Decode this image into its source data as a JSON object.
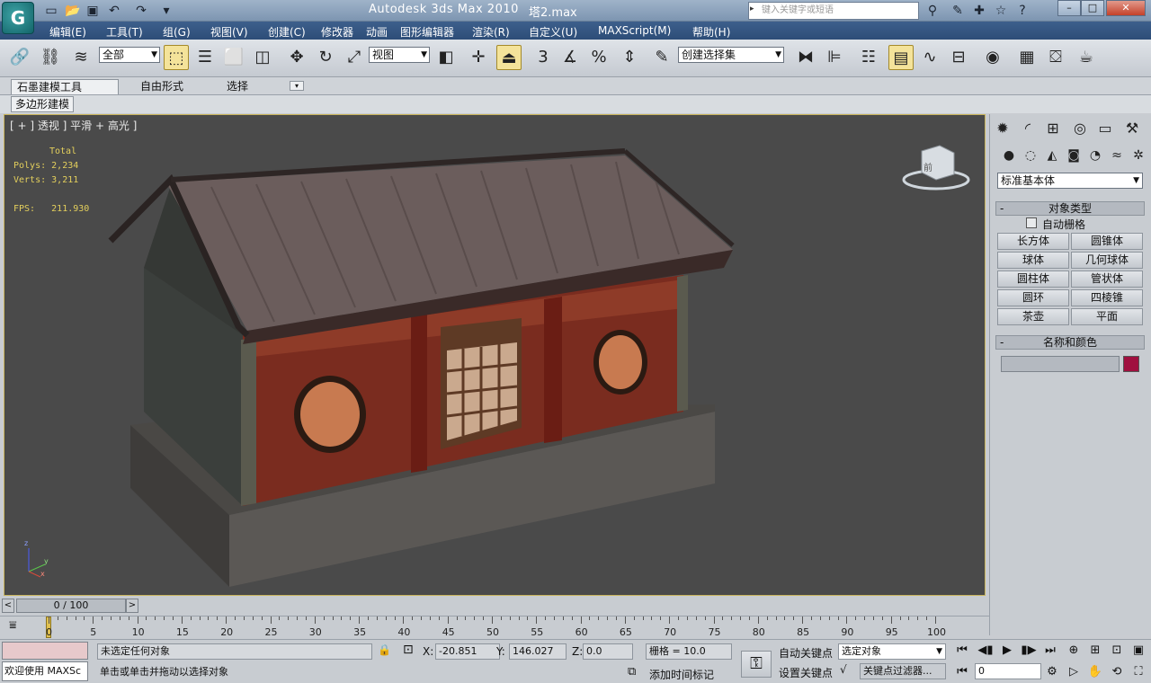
{
  "window": {
    "title": "Autodesk 3ds Max  2010",
    "file": "塔2.max",
    "search_placeholder": "键入关键字或短语"
  },
  "menu": [
    "编辑(E)",
    "工具(T)",
    "组(G)",
    "视图(V)",
    "创建(C)",
    "修改器",
    "动画",
    "图形编辑器",
    "渲染(R)",
    "自定义(U)",
    "MAXScript(M)",
    "帮助(H)"
  ],
  "toolbar": {
    "selection_filter": "全部",
    "ref_coord": "视图",
    "named_selection": "创建选择集",
    "snap_label": "3",
    "percent_label": "%"
  },
  "ribbon": {
    "tabs": [
      "石墨建模工具",
      "自由形式",
      "选择"
    ],
    "subtab": "多边形建模"
  },
  "viewport": {
    "label": "[ + ] 透视 ] 平滑 + 高光 ]",
    "stats_header": "Total",
    "polys_label": "Polys:",
    "polys_value": "2,234",
    "verts_label": "Verts:",
    "verts_value": "3,211",
    "fps_label": "FPS:",
    "fps_value": "211.930"
  },
  "command_panel": {
    "category": "标准基本体",
    "rollout_object_type": "对象类型",
    "auto_grid": "自动栅格",
    "primitives": [
      "长方体",
      "圆锥体",
      "球体",
      "几何球体",
      "圆柱体",
      "管状体",
      "圆环",
      "四棱锥",
      "茶壶",
      "平面"
    ],
    "rollout_name_color": "名称和颜色",
    "object_color": "#a0103f"
  },
  "timeline": {
    "frame_display": "0 / 100",
    "ticks": [
      "0",
      "5",
      "10",
      "15",
      "20",
      "25",
      "30",
      "35",
      "40",
      "45",
      "50",
      "55",
      "60",
      "65",
      "70",
      "75",
      "80",
      "85",
      "90",
      "95",
      "100"
    ]
  },
  "status": {
    "maxscript_label": "欢迎使用 MAXSc",
    "selection_status": "未选定任何对象",
    "prompt": "单击或单击并拖动以选择对象",
    "x_label": "X:",
    "x_value": "-20.851",
    "y_label": "Y:",
    "y_value": "146.027",
    "z_label": "Z:",
    "z_value": "0.0",
    "grid": "栅格 = 10.0",
    "add_time_tag": "添加时间标记",
    "auto_key": "自动关键点",
    "set_key": "设置关键点",
    "key_mode_select": "选定对象",
    "key_filters": "关键点过滤器...",
    "current_frame": "0"
  }
}
